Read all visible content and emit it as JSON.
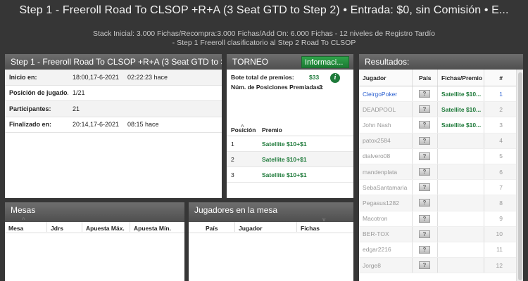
{
  "header": {
    "title": "Step 1 - Freeroll Road To CLSOP +R+A (3 Seat GTD to Step 2) • Entrada: $0, sin Comisión • E...",
    "subtitle1": "Stack Inicial: 3.000 Fichas/Recompra:3.000 Fichas/Add On: 6.000 Fichas -  12 niveles de Registro Tardío",
    "subtitle2": "- Step 1 Freeroll clasificatorio al Step 2 Road To CLSOP"
  },
  "info_panel": {
    "title": "Step 1 - Freeroll Road To CLSOP +R+A (3 Seat GTD to St...",
    "rows": [
      {
        "label": "Inicio en:",
        "value1": "18:00,17-6-2021",
        "value2": "02:22:23 hace"
      },
      {
        "label": "Posición de jugado...",
        "value1": "1/21",
        "value2": ""
      },
      {
        "label": "Participantes:",
        "value1": "21",
        "value2": ""
      },
      {
        "label": "Finalizado en:",
        "value1": "20:14,17-6-2021",
        "value2": "08:15 hace"
      }
    ]
  },
  "torneo_panel": {
    "title": "TORNEO",
    "info_button": "Informaci...",
    "info_icon": "i",
    "prize_pool_label": "Bote total de premios:",
    "prize_pool_value": "$33",
    "paid_positions_label": "Núm. de Posiciones Premiadas.:",
    "paid_positions_value": "3",
    "columns": [
      "Posición",
      "Premio"
    ],
    "rows": [
      {
        "pos": "1",
        "prize": "Satellite $10+$1"
      },
      {
        "pos": "2",
        "prize": "Satellite $10+$1"
      },
      {
        "pos": "3",
        "prize": "Satellite $10+$1"
      }
    ]
  },
  "results_panel": {
    "title": "Resultados:",
    "columns": [
      "Jugador",
      "País",
      "Fichas/Premio",
      "#"
    ],
    "flag_glyph": "?",
    "rows": [
      {
        "player": "CleirgoPoker",
        "prize": "Satellite $10...",
        "rank": "1"
      },
      {
        "player": "DEADPOOL",
        "prize": "Satellite $10...",
        "rank": "2"
      },
      {
        "player": "John Nash",
        "prize": "Satellite $10...",
        "rank": "3"
      },
      {
        "player": "patox2584",
        "prize": "",
        "rank": "4"
      },
      {
        "player": "dialvero08",
        "prize": "",
        "rank": "5"
      },
      {
        "player": "mandenplata",
        "prize": "",
        "rank": "6"
      },
      {
        "player": "SebaSantamaria",
        "prize": "",
        "rank": "7"
      },
      {
        "player": "Pegasus1282",
        "prize": "",
        "rank": "8"
      },
      {
        "player": "Macotron",
        "prize": "",
        "rank": "9"
      },
      {
        "player": "BER-TOX",
        "prize": "",
        "rank": "10"
      },
      {
        "player": "edgar2216",
        "prize": "",
        "rank": "11"
      },
      {
        "player": "Jorge8",
        "prize": "",
        "rank": "12"
      }
    ]
  },
  "mesas_panel": {
    "title": "Mesas",
    "columns": [
      "Mesa",
      "Jdrs",
      "Apuesta Máx.",
      "Apuesta Mín."
    ]
  },
  "jugadores_panel": {
    "title": "Jugadores en la mesa",
    "columns": [
      "País",
      "Jugador",
      "Fichas"
    ]
  }
}
